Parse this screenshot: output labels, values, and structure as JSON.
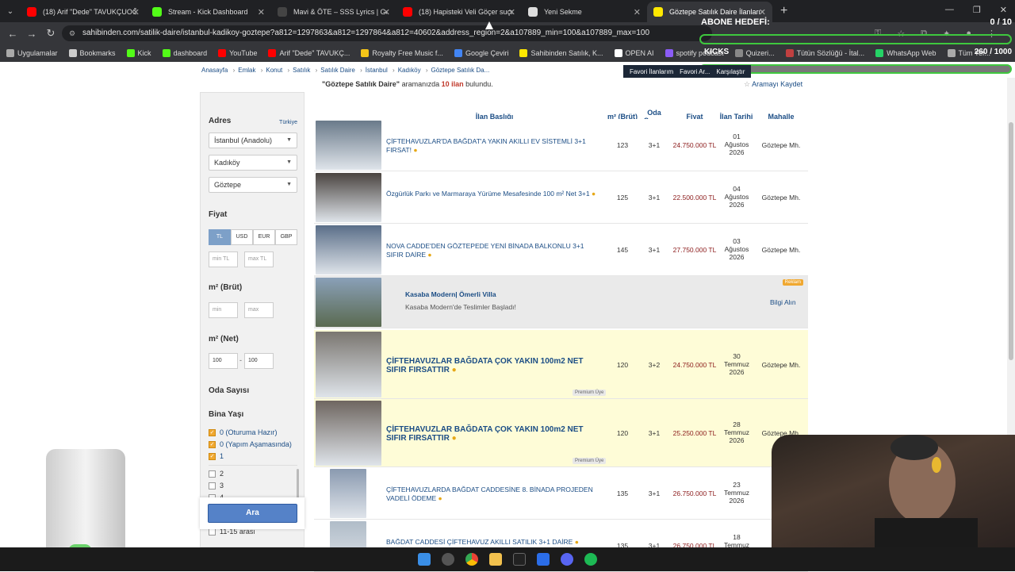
{
  "tabs": [
    {
      "label": "(18) Arif \"Dede\" TAVUKÇUOĞLU",
      "icon": "youtube-icon",
      "color": "#ff0000"
    },
    {
      "label": "Stream - Kick Dashboard",
      "icon": "kick-icon",
      "color": "#53fc18"
    },
    {
      "label": "Mavi & ÖTE – SSS Lyrics | Geniu",
      "icon": "genius-icon",
      "color": "#444444"
    },
    {
      "label": "(18) Hapisteki Veli Göçer suçu b",
      "icon": "youtube-icon",
      "color": "#ff0000"
    },
    {
      "label": "Yeni Sekme",
      "icon": "chrome-icon",
      "color": "#dddddd"
    },
    {
      "label": "Göztepe Satılık Daire İlanları ve",
      "icon": "sahibinden-icon",
      "color": "#ffe800"
    }
  ],
  "url": "sahibinden.com/satilik-daire/istanbul-kadikoy-goztepe?a812=1297863&a812=1297864&a812=40602&address_region=2&a107889_min=100&a107889_max=100",
  "bookmarks": [
    {
      "label": "Uygulamalar",
      "color": "#aaaaaa"
    },
    {
      "label": "Bookmarks",
      "color": "#cccccc"
    },
    {
      "label": "Kick",
      "color": "#53fc18"
    },
    {
      "label": "dashboard",
      "color": "#53fc18"
    },
    {
      "label": "YouTube",
      "color": "#ff0000"
    },
    {
      "label": "Arif \"Dede\" TAVUKÇ...",
      "color": "#ff0000"
    },
    {
      "label": "Royalty Free Music f...",
      "color": "#f5c518"
    },
    {
      "label": "Google Çeviri",
      "color": "#4285f4"
    },
    {
      "label": "Sahibinden Satılık, K...",
      "color": "#ffe800"
    },
    {
      "label": "OPEN AI",
      "color": "#ffffff"
    },
    {
      "label": "spotify podcast",
      "color": "#8b5cf6"
    },
    {
      "label": "Quizeri...",
      "color": "#888888"
    },
    {
      "label": "Tütün Sözlüğü - İtal...",
      "color": "#c04040"
    },
    {
      "label": "WhatsApp Web",
      "color": "#25d366"
    },
    {
      "label": "Tüm Yer...",
      "color": "#aaaaaa"
    }
  ],
  "overlay": {
    "abone": "ABONE HEDEFİ:",
    "abone_count": "0 / 10",
    "kicks": "KICKS",
    "kicks_count": "260 / 1000"
  },
  "breadcrumb": [
    "Anasayfa",
    "Emlak",
    "Konut",
    "Satılık",
    "Satılık Daire",
    "İstanbul",
    "Kadıköy",
    "Göztepe Satılık Da..."
  ],
  "favbar": [
    "Favori İlanlarım",
    "Favori Ar...",
    "Karşılaştır"
  ],
  "search": {
    "query": "\"Göztepe Satılık Daire\"",
    "middle": "aramanızda",
    "count": "10 ilan",
    "end": "bulundu.",
    "save": "Aramayı Kaydet"
  },
  "sidebar": {
    "adres_title": "Adres",
    "country_link": "Türkiye",
    "province": "İstanbul (Anadolu)",
    "district": "Kadıköy",
    "neighborhood": "Göztepe",
    "fiyat_title": "Fiyat",
    "currencies": [
      "TL",
      "USD",
      "EUR",
      "GBP"
    ],
    "min_price_ph": "min TL",
    "max_price_ph": "max TL",
    "brut_title": "m² (Brüt)",
    "brut_min_ph": "min",
    "brut_max_ph": "max",
    "net_title": "m² (Net)",
    "net_min": "100",
    "net_max": "100",
    "oda_title": "Oda Sayısı",
    "bina_title": "Bina Yaşı",
    "bina_checked": [
      "0 (Oturuma Hazır)",
      "0 (Yapım Aşamasında)",
      "1"
    ],
    "bina_unchecked": [
      "2",
      "3",
      "4"
    ],
    "bina_last": "11-15 arası",
    "search_button": "Ara"
  },
  "columns": [
    "İlan Başlığı",
    "m² (Brüt)",
    "Oda Sayısı",
    "Fiyat",
    "İlan Tarihi",
    "Mahalle"
  ],
  "listings": [
    {
      "title": "ÇİFTEHAVUZLAR'DA BAĞDAT'A YAKIN AKILLI EV SİSTEMLİ 3+1 FIRSAT!",
      "m2": "123",
      "rooms": "3+1",
      "price": "24.750.000 TL",
      "date": "01 Ağustos 2026",
      "district": "Göztepe Mh.",
      "thumb": "#6a7a8a"
    },
    {
      "title": "Özgürlük Parkı ve Marmaraya Yürüme Mesafesinde 100 m² Net 3+1",
      "m2": "125",
      "rooms": "3+1",
      "price": "22.500.000 TL",
      "date": "04 Ağustos 2026",
      "district": "Göztepe Mh.",
      "thumb": "#4a4440"
    },
    {
      "title": "NOVA CADDE'DEN GÖZTEPEDE YENİ BİNADA BALKONLU 3+1 SIFIR DAİRE",
      "m2": "145",
      "rooms": "3+1",
      "price": "27.750.000 TL",
      "date": "03 Ağustos 2026",
      "district": "Göztepe Mh.",
      "thumb": "#5a6e88"
    },
    {
      "title": "ÇİFTEHAVUZLAR BAĞDATA ÇOK YAKIN 100m2 NET SIFIR FIRSATTIR",
      "m2": "120",
      "rooms": "3+2",
      "price": "24.750.000 TL",
      "date": "30 Temmuz 2026",
      "district": "Göztepe Mh.",
      "thumb": "#7a7670",
      "premium": "Premium Üye"
    },
    {
      "title": "ÇİFTEHAVUZLAR BAĞDATA ÇOK YAKIN 100m2 NET SIFIR FIRSATTIR",
      "m2": "120",
      "rooms": "3+1",
      "price": "25.250.000 TL",
      "date": "28 Temmuz 2026",
      "district": "Göztepe Mh.",
      "thumb": "#6e6660",
      "premium": "Premium Üye"
    },
    {
      "title": "ÇİFTEHAVUZLARDA BAĞDAT CADDESİNE 8. BİNADA PROJEDEN VADELİ ÖDEME",
      "m2": "135",
      "rooms": "3+1",
      "price": "26.750.000 TL",
      "date": "23 Temmuz 2026",
      "district": "Göz...",
      "thumb": "#8a9ab0"
    },
    {
      "title": "BAĞDAT CADDESİ ÇİFTEHAVUZ AKILLI SATILIK 3+1 DAİRE",
      "m2": "135",
      "rooms": "3+1",
      "price": "26.750.000 TL",
      "date": "18 Temmuz",
      "district": "",
      "thumb": "#b0bcc8"
    }
  ],
  "ad": {
    "title": "Kasaba Modern| Ömerli Villa",
    "subtitle": "Kasaba Modern'de Teslimler Başladı!",
    "badge": "Reklam",
    "cta": "Bilgi Alın",
    "thumb": "#5a6a50"
  },
  "webcam_logo": "KK"
}
